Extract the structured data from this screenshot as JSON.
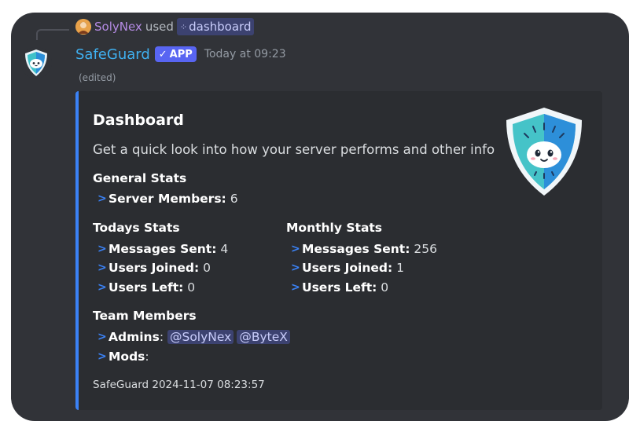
{
  "reply": {
    "user": "SolyNex",
    "used_text": "used",
    "command": "dashboard"
  },
  "message": {
    "author": "SafeGuard",
    "badge": "APP",
    "timestamp": "Today at 09:23",
    "edited": "(edited)"
  },
  "embed": {
    "accent_color": "#3b82f6",
    "title": "Dashboard",
    "description": "Get a quick look into how your server performs and other info",
    "general_title": "General Stats",
    "general_items": [
      {
        "label": "Server Members:",
        "value": "6"
      }
    ],
    "today_title": "Todays Stats",
    "today_items": [
      {
        "label": "Messages Sent:",
        "value": "4"
      },
      {
        "label": "Users Joined:",
        "value": "0"
      },
      {
        "label": "Users Left:",
        "value": "0"
      }
    ],
    "monthly_title": "Monthly Stats",
    "monthly_items": [
      {
        "label": "Messages Sent:",
        "value": "256"
      },
      {
        "label": "Users Joined:",
        "value": "1"
      },
      {
        "label": "Users Left:",
        "value": "0"
      }
    ],
    "team_title": "Team Members",
    "admins_label": "Admins",
    "admins": [
      "@SolyNex",
      "@ByteX"
    ],
    "mods_label": "Mods",
    "footer": "SafeGuard 2024-11-07 08:23:57"
  }
}
